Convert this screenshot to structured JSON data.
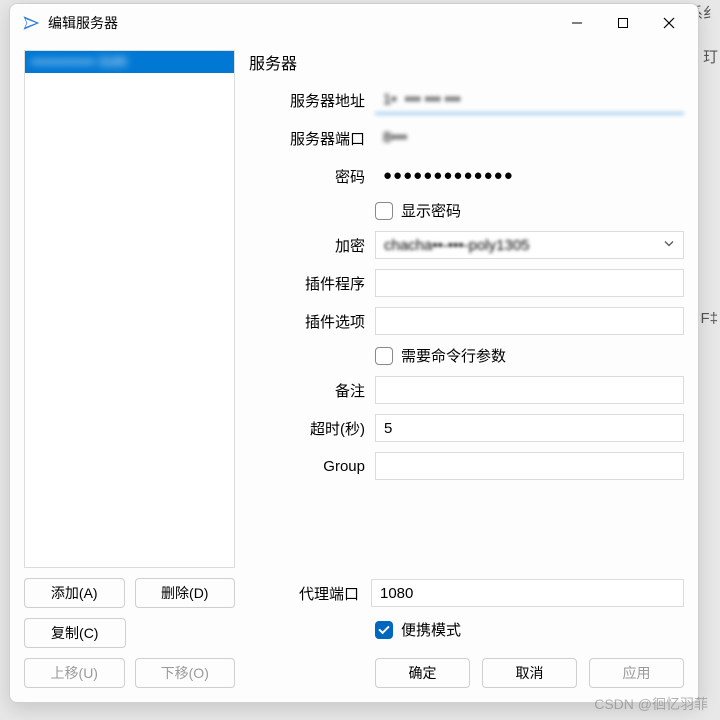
{
  "window": {
    "title": "编辑服务器"
  },
  "sidebar": {
    "items": [
      {
        "label": "•••••••••••••• 3185"
      }
    ]
  },
  "buttons": {
    "add": "添加(A)",
    "delete": "删除(D)",
    "copy": "复制(C)",
    "moveUp": "上移(U)",
    "moveDown": "下移(O)"
  },
  "form": {
    "groupTitle": "服务器",
    "labels": {
      "address": "服务器地址",
      "port": "服务器端口",
      "password": "密码",
      "showPassword": "显示密码",
      "encryption": "加密",
      "plugin": "插件程序",
      "pluginOpts": "插件选项",
      "needArgs": "需要命令行参数",
      "remarks": "备注",
      "timeout": "超时(秒)",
      "group": "Group"
    },
    "values": {
      "address": "1•  ••• ••• •••",
      "port": "8•••",
      "password": "●●●●●●●●●●●●●",
      "encryption": "chacha••-•••-poly1305",
      "plugin": "",
      "pluginOpts": "",
      "remarks": "",
      "timeout": "5",
      "group": ""
    }
  },
  "footer": {
    "proxyPortLabel": "代理端口",
    "proxyPortValue": "1080",
    "portableLabel": "便携模式",
    "ok": "确定",
    "cancel": "取消",
    "apply": "应用"
  },
  "watermark": "CSDN @徊忆羽菲",
  "bg": {
    "a": "系纟",
    "b": "玎",
    "c": "F‡"
  }
}
